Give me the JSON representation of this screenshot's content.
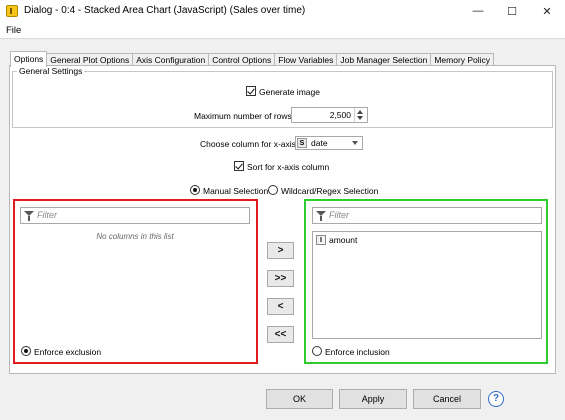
{
  "window": {
    "title": "Dialog - 0:4 - Stacked Area Chart (JavaScript) (Sales over time)",
    "minimize_glyph": "—",
    "maximize_glyph": "☐",
    "close_glyph": "✕",
    "app_icon": "knime-node-icon"
  },
  "menu": {
    "file": "File"
  },
  "tabs": [
    {
      "label": "Options",
      "active": true
    },
    {
      "label": "General Plot Options"
    },
    {
      "label": "Axis Configuration"
    },
    {
      "label": "Control Options"
    },
    {
      "label": "Flow Variables"
    },
    {
      "label": "Job Manager Selection"
    },
    {
      "label": "Memory Policy"
    }
  ],
  "general_settings": {
    "title": "General Settings",
    "generate_image_label": "Generate image",
    "generate_image_checked": true,
    "max_rows_label": "Maximum number of rows",
    "max_rows_value": "2,500"
  },
  "x_axis": {
    "label": "Choose column for x-axis",
    "type_badge": "S",
    "value": "date",
    "sort_label": "Sort for x-axis column",
    "sort_checked": true
  },
  "selection_mode": {
    "manual_label": "Manual Selection",
    "manual_selected": true,
    "wildcard_label": "Wildcard/Regex Selection"
  },
  "exclude_panel": {
    "filter_placeholder": "Filter",
    "empty_message": "No columns in this list",
    "enforce_label": "Enforce exclusion",
    "enforce_selected": true
  },
  "include_panel": {
    "filter_placeholder": "Filter",
    "items": [
      {
        "type": "I",
        "name": "amount"
      }
    ],
    "enforce_label": "Enforce inclusion",
    "enforce_selected": false
  },
  "move_buttons": {
    "add": ">",
    "add_all": ">>",
    "remove": "<",
    "remove_all": "<<"
  },
  "footer": {
    "ok": "OK",
    "apply": "Apply",
    "cancel": "Cancel",
    "help": "?"
  },
  "colors": {
    "exclude_border": "#e01c1c",
    "include_border": "#2ecc2e"
  }
}
